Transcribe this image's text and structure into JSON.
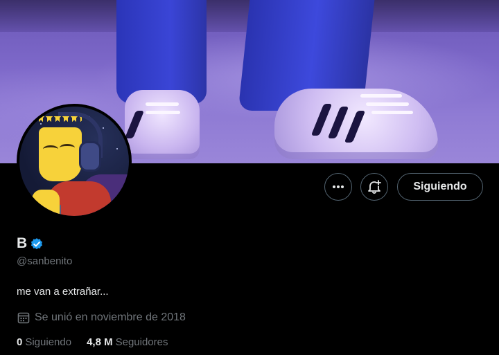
{
  "profile": {
    "name": "B",
    "handle": "@sanbenito",
    "bio": "me van a extrañar...",
    "joined": "Se unió en noviembre de 2018",
    "verified": true
  },
  "stats": {
    "following_count": "0",
    "following_label": "Siguiendo",
    "followers_count": "4,8 M",
    "followers_label": "Seguidores"
  },
  "actions": {
    "follow_label": "Siguiendo",
    "more_icon": "more-horizontal-icon",
    "notify_icon": "bell-plus-icon"
  },
  "colors": {
    "background": "#000000",
    "text_primary": "#e7e9ea",
    "text_secondary": "#71767b",
    "border": "#536471",
    "verified_blue": "#1d9bf0"
  }
}
